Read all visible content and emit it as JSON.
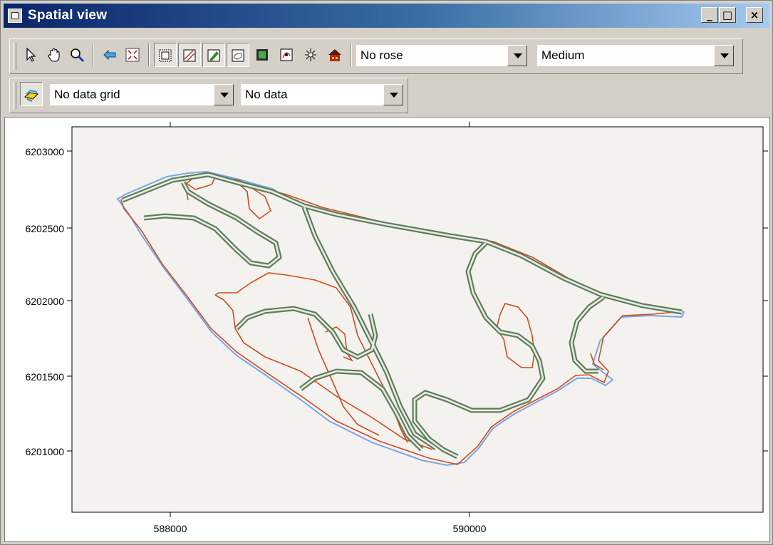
{
  "window": {
    "title": "Spatial view",
    "minimize_label": "_",
    "maximize_label": "□",
    "close_label": "×"
  },
  "toolbar1": {
    "tools": [
      "pointer-icon",
      "hand-pan-icon",
      "zoom-icon",
      "back-arrow-icon",
      "zoom-extent-icon",
      "map-frame-icon",
      "layer-hatch-icon",
      "layer-green-icon",
      "layer-outline-icon",
      "layer-fill-icon",
      "layer-toggle-icon",
      "wind-rose-icon",
      "building-icon"
    ],
    "rose_select": "No rose",
    "size_select": "Medium"
  },
  "toolbar2": {
    "tools": [
      "data-grid-icon"
    ],
    "grid_select": "No data grid",
    "data_select": "No data"
  },
  "map": {
    "y_ticks": [
      "6203000",
      "6202500",
      "6202000",
      "6201500",
      "6201000"
    ],
    "x_ticks": [
      "588000",
      "590000"
    ],
    "colors": {
      "outline_blue": "#7aa6e6",
      "contour_red": "#d24a1e",
      "track_green": "#5f7d5a",
      "background": "#f3f2ef"
    }
  }
}
